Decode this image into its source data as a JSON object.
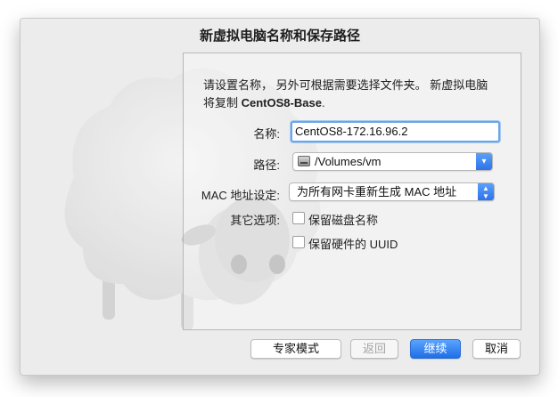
{
  "dialog": {
    "title": "新虚拟电脑名称和保存路径",
    "description_line1": "请设置名称， 另外可根据需要选择文件夹。 新虚拟电脑",
    "description_prefix": "将复制 ",
    "description_source": "CentOS8-Base",
    "description_suffix": "."
  },
  "form": {
    "name_label": "名称:",
    "name_value": "CentOS8-172.16.96.2",
    "path_label": "路径:",
    "path_value": "/Volumes/vm",
    "mac_label": "MAC 地址设定:",
    "mac_value": "为所有网卡重新生成 MAC 地址",
    "other_label": "其它选项:",
    "keep_disk_names_label": "保留磁盘名称",
    "keep_disk_names_checked": false,
    "keep_uuid_label": "保留硬件的 UUID",
    "keep_uuid_checked": false
  },
  "buttons": {
    "expert": "专家模式",
    "back": "返回",
    "continue": "继续",
    "cancel": "取消"
  },
  "colors": {
    "accent": "#2d73ea",
    "window_bg": "#ececec"
  },
  "icons": {
    "popup_path": "chevron-down-icon",
    "popup_mac": "up-down-stepper-icon",
    "path_disk": "hard-disk-icon",
    "background": "sheep-illustration"
  }
}
